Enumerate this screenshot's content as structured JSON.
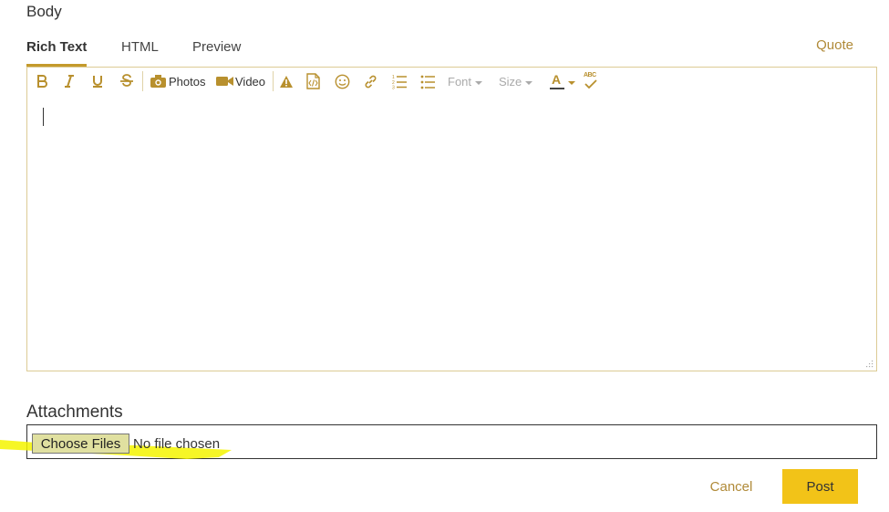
{
  "body_label": "Body",
  "tabs": [
    {
      "label": "Rich Text",
      "active": true
    },
    {
      "label": "HTML",
      "active": false
    },
    {
      "label": "Preview",
      "active": false
    }
  ],
  "quote_label": "Quote",
  "toolbar": {
    "bold_icon": "bold-icon",
    "italic_icon": "italic-icon",
    "underline_icon": "underline-icon",
    "strike_icon": "strikethrough-icon",
    "photos_label": "Photos",
    "video_label": "Video",
    "font_label": "Font",
    "size_label": "Size",
    "color_letter": "A",
    "spell_label": "ABC"
  },
  "attachments": {
    "label": "Attachments",
    "choose_label": "Choose Files",
    "status": "No file chosen"
  },
  "actions": {
    "cancel_label": "Cancel",
    "post_label": "Post"
  },
  "colors": {
    "accent": "#b8902e",
    "post_button": "#f2c318",
    "highlight": "#f5f500"
  }
}
